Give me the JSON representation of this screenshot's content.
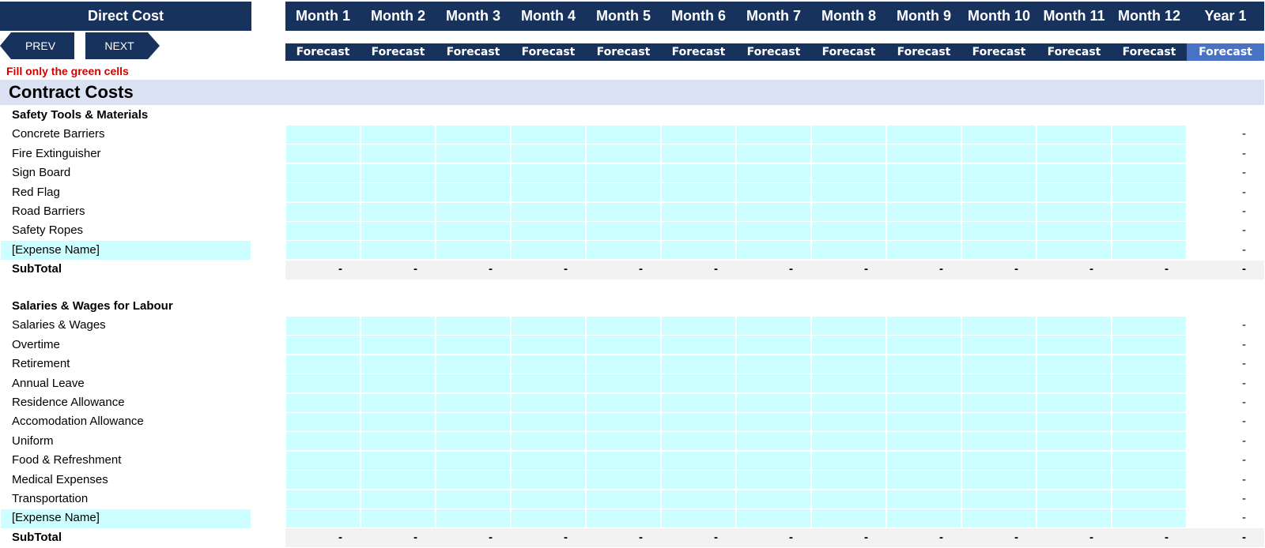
{
  "header": {
    "title": "Direct Cost",
    "months": [
      "Month 1",
      "Month 2",
      "Month 3",
      "Month 4",
      "Month 5",
      "Month 6",
      "Month 7",
      "Month 8",
      "Month 9",
      "Month 10",
      "Month 11",
      "Month 12"
    ],
    "year_label": "Year 1",
    "forecast_label": "Forecast"
  },
  "nav": {
    "prev": "PREV",
    "next": "NEXT"
  },
  "note": "Fill only the green cells",
  "section_title": "Contract Costs",
  "groups": [
    {
      "title": "Safety Tools & Materials",
      "items": [
        "Concrete Barriers",
        "Fire Extinguisher",
        "Sign Board",
        "Red Flag",
        "Road Barriers",
        "Safety Ropes",
        "[Expense Name]"
      ],
      "subtotal_label": "SubTotal"
    },
    {
      "title": "Salaries & Wages for Labour",
      "items": [
        "Salaries & Wages",
        "Overtime",
        "Retirement",
        "Annual Leave",
        "Residence Allowance",
        "Accomodation Allowance",
        "Uniform",
        "Food & Refreshment",
        "Medical Expenses",
        "Transportation",
        "[Expense Name]"
      ],
      "subtotal_label": "SubTotal"
    }
  ],
  "empty_value": "-",
  "colors": {
    "header": "#17325c",
    "year_forecast": "#4a72c4",
    "input_fill": "#ccffff",
    "section_band": "#d9e1f2",
    "subtotal_fill": "#f2f2f2",
    "note": "#d40000"
  }
}
